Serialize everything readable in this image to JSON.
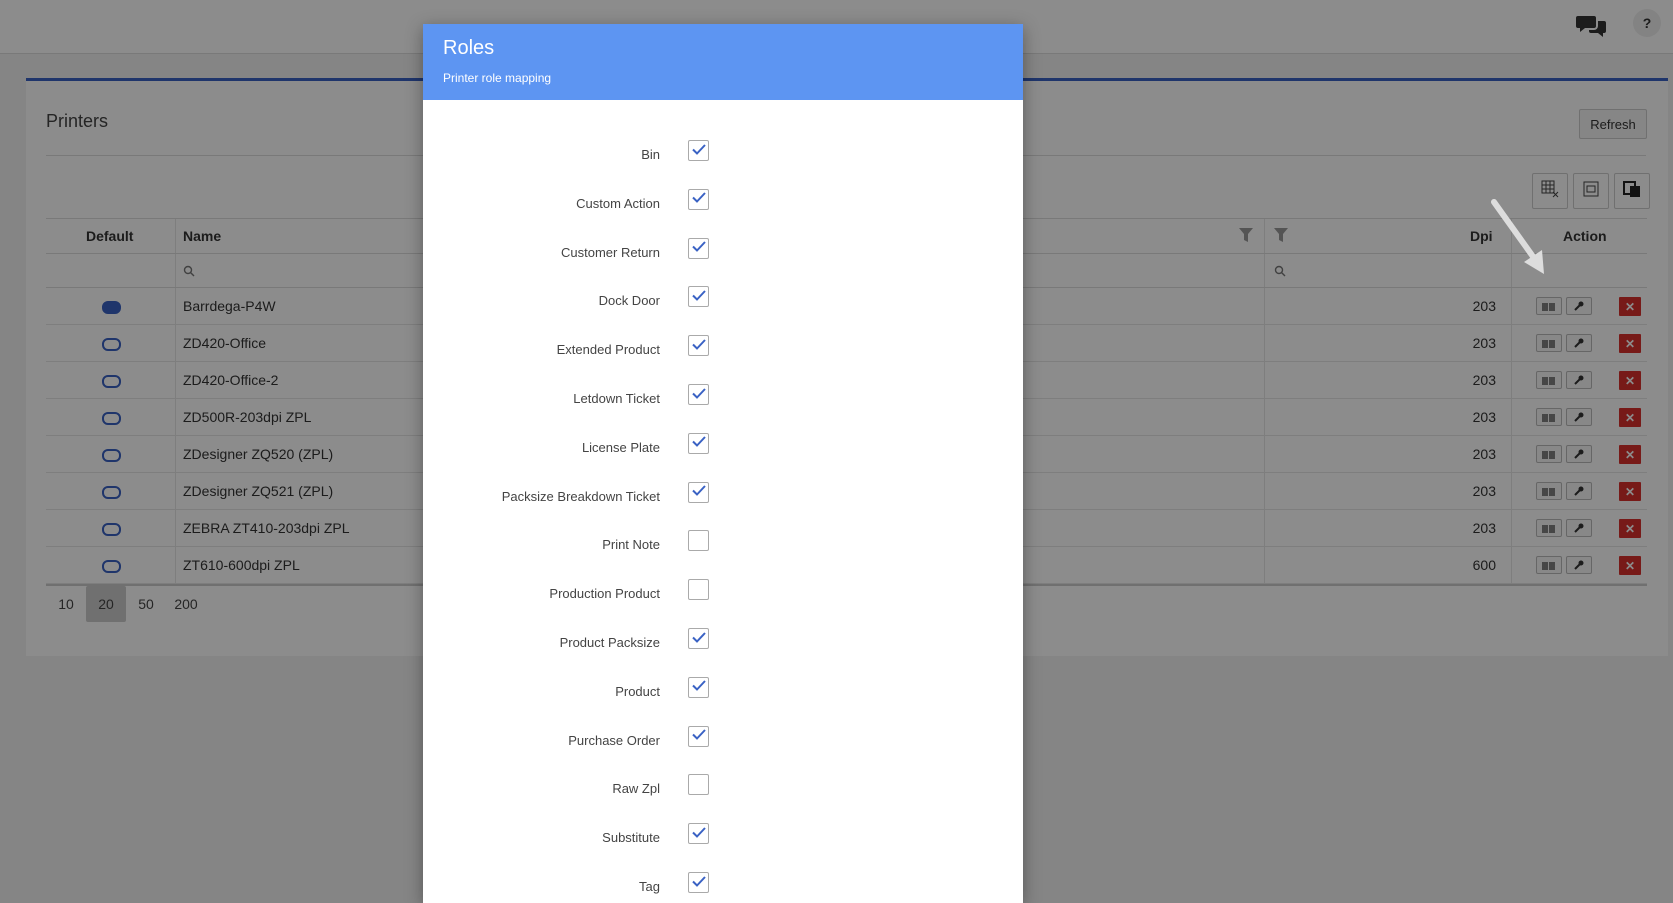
{
  "header": {
    "help_label": "?"
  },
  "printers": {
    "title": "Printers",
    "refresh_label": "Refresh",
    "columns": {
      "default": "Default",
      "name": "Name",
      "dpi": "Dpi",
      "action": "Action"
    },
    "rows": [
      {
        "default": true,
        "name": "Barrdega-P4W",
        "dpi": "203"
      },
      {
        "default": false,
        "name": "ZD420-Office",
        "dpi": "203"
      },
      {
        "default": false,
        "name": "ZD420-Office-2",
        "dpi": "203"
      },
      {
        "default": false,
        "name": "ZD500R-203dpi ZPL",
        "dpi": "203"
      },
      {
        "default": false,
        "name": "ZDesigner ZQ520 (ZPL)",
        "dpi": "203"
      },
      {
        "default": false,
        "name": "ZDesigner ZQ521 (ZPL)",
        "dpi": "203"
      },
      {
        "default": false,
        "name": "ZEBRA ZT410-203dpi ZPL",
        "dpi": "203"
      },
      {
        "default": false,
        "name": "ZT610-600dpi ZPL",
        "dpi": "600"
      }
    ],
    "page_sizes": [
      "10",
      "20",
      "50",
      "200"
    ],
    "active_page_size": "20"
  },
  "modal": {
    "title": "Roles",
    "subtitle": "Printer role mapping",
    "roles": [
      {
        "label": "Bin",
        "checked": true
      },
      {
        "label": "Custom Action",
        "checked": true
      },
      {
        "label": "Customer Return",
        "checked": true
      },
      {
        "label": "Dock Door",
        "checked": true
      },
      {
        "label": "Extended Product",
        "checked": true
      },
      {
        "label": "Letdown Ticket",
        "checked": true
      },
      {
        "label": "License Plate",
        "checked": true
      },
      {
        "label": "Packsize Breakdown Ticket",
        "checked": true
      },
      {
        "label": "Print Note",
        "checked": false
      },
      {
        "label": "Production Product",
        "checked": false
      },
      {
        "label": "Product Packsize",
        "checked": true
      },
      {
        "label": "Product",
        "checked": true
      },
      {
        "label": "Purchase Order",
        "checked": true
      },
      {
        "label": "Raw Zpl",
        "checked": false
      },
      {
        "label": "Substitute",
        "checked": true
      },
      {
        "label": "Tag",
        "checked": true
      }
    ]
  },
  "colors": {
    "accent": "#3a62c4",
    "modal_header": "#5d95f2",
    "delete": "#d9302c"
  }
}
